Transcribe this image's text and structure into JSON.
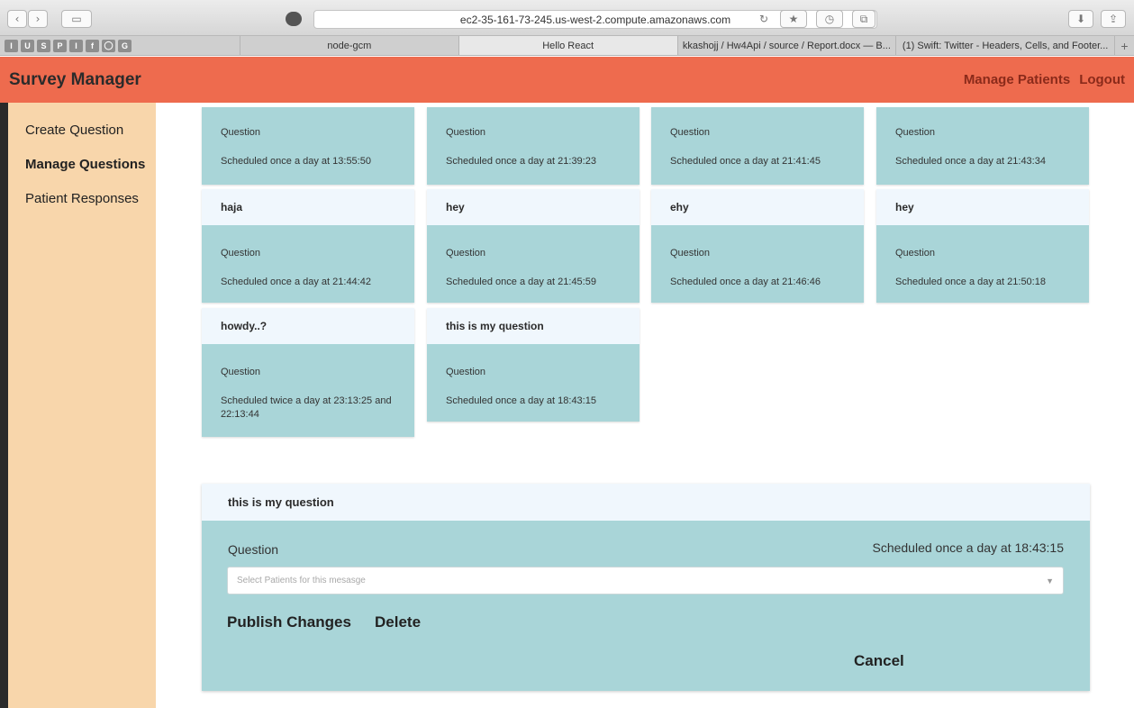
{
  "browser": {
    "url": "ec2-35-161-73-245.us-west-2.compute.amazonaws.com",
    "favorites": [
      "I",
      "U",
      "S",
      "P",
      "I",
      "f",
      "◯",
      "G"
    ],
    "tabs": [
      {
        "label": "node-gcm",
        "active": false
      },
      {
        "label": "Hello React",
        "active": true
      },
      {
        "label": "kkashojj / Hw4Api / source / Report.docx — B...",
        "active": false
      },
      {
        "label": "(1) Swift: Twitter - Headers, Cells, and Footer...",
        "active": false
      }
    ],
    "new_tab": "+"
  },
  "header": {
    "title": "Survey Manager",
    "manage_patients": "Manage Patients",
    "logout": "Logout",
    "color": "#ee6b4e"
  },
  "sidebar": {
    "items": [
      {
        "label": "Create Question",
        "active": false
      },
      {
        "label": "Manage Questions",
        "active": true
      },
      {
        "label": "Patient Responses",
        "active": false
      }
    ]
  },
  "questions": [
    {
      "title": "",
      "type": "Question",
      "schedule": "Scheduled once a day at 13:55:50"
    },
    {
      "title": "",
      "type": "Question",
      "schedule": "Scheduled once a day at 21:39:23"
    },
    {
      "title": "",
      "type": "Question",
      "schedule": "Scheduled once a day at 21:41:45"
    },
    {
      "title": "",
      "type": "Question",
      "schedule": "Scheduled once a day at 21:43:34"
    },
    {
      "title": "haja",
      "type": "Question",
      "schedule": "Scheduled once a day at 21:44:42"
    },
    {
      "title": "hey",
      "type": "Question",
      "schedule": "Scheduled once a day at 21:45:59"
    },
    {
      "title": "ehy",
      "type": "Question",
      "schedule": "Scheduled once a day at 21:46:46"
    },
    {
      "title": "hey",
      "type": "Question",
      "schedule": "Scheduled once a day at 21:50:18"
    },
    {
      "title": "howdy..?",
      "type": "Question",
      "schedule": "Scheduled twice a day at 23:13:25 and 22:13:44"
    },
    {
      "title": "this is my question",
      "type": "Question",
      "schedule": "Scheduled once a day at 18:43:15"
    }
  ],
  "editor": {
    "title": "this is my question",
    "type": "Question",
    "schedule": "Scheduled once a day at 18:43:15",
    "select_placeholder": "Select Patients for this mesasge",
    "publish": "Publish Changes",
    "delete": "Delete",
    "cancel": "Cancel"
  },
  "colors": {
    "card_body": "#a9d5d8",
    "card_head": "#f0f7fd",
    "sidebar": "#f8d6ab"
  }
}
